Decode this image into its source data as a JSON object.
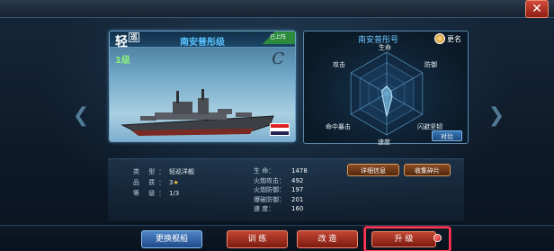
{
  "window": {
    "close_glyph": "✕"
  },
  "nav": {
    "prev_glyph": "❮",
    "next_glyph": "❯"
  },
  "ship_card": {
    "class_char": "轻",
    "class_sub": "巡",
    "name": "南安普彤级",
    "owned_tag": "已上阵",
    "level": "1级",
    "grade": "C"
  },
  "radar": {
    "title": "南安普彤号",
    "rename_label": "更名",
    "axes": [
      "生命",
      "防御",
      "闪避坚韧",
      "速度",
      "命中暴击",
      "攻击"
    ],
    "values": [
      0.18,
      0.12,
      0.15,
      0.55,
      0.12,
      0.14
    ],
    "contrast_label": "对比"
  },
  "info": {
    "type_label": "类 型：",
    "type_value": "轻巡洋舰",
    "quality_label": "品 质：",
    "quality_value": "3",
    "grade_label": "等 级：",
    "grade_value": "1/3"
  },
  "stats": [
    {
      "label": "生 命：",
      "value": "1478"
    },
    {
      "label": "火炮攻击：",
      "value": "492"
    },
    {
      "label": "火炮防御：",
      "value": "197"
    },
    {
      "label": "爆破防御：",
      "value": "201"
    },
    {
      "label": "速 度：",
      "value": "160"
    }
  ],
  "buttons": {
    "detail": "详细信息",
    "fragments": "收集碎片",
    "change_ship": "更换舰船",
    "train": "训 练",
    "refit": "改 造",
    "upgrade": "升 级"
  }
}
